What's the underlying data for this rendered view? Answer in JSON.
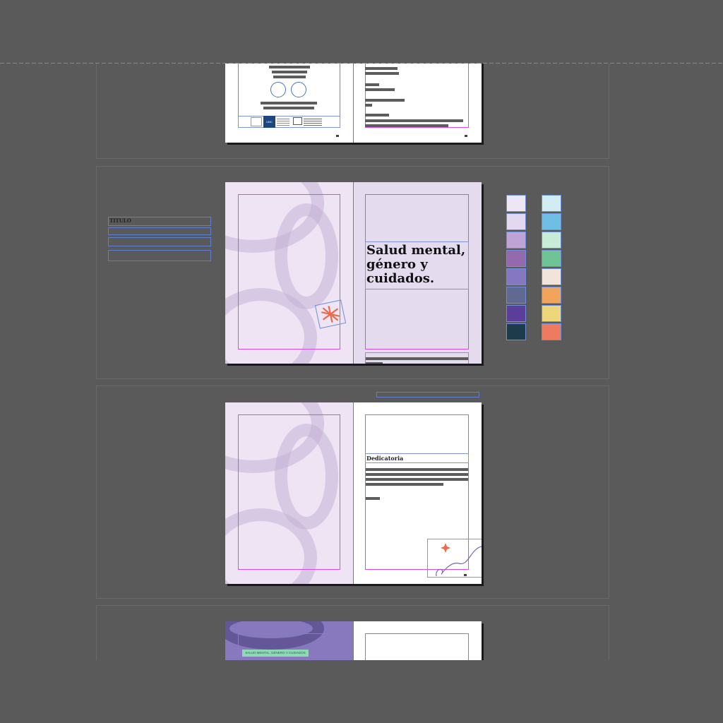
{
  "spread2": {
    "title_parts": {
      "line1": "Salud mental,",
      "line2": "género y",
      "line3": "cuidados."
    },
    "pasteboard_label": "TITULO"
  },
  "spread3": {
    "heading": "Dedicatoria"
  },
  "spread1": {
    "logo_text": "UNC"
  },
  "spread4": {
    "tag": "SALUD MENTAL, GÉNERO Y CUIDADOS"
  },
  "swatches": {
    "left": [
      "#ede6f5",
      "#e2d8ef",
      "#c0a3d6",
      "#9469ad",
      "#8578c0",
      "#606a90",
      "#5b3d9a",
      "#1e3b4c"
    ],
    "right": [
      "#d2ecf3",
      "#6fbfe5",
      "#c6ecd7",
      "#6fc495",
      "#f1e4d9",
      "#f0a45c",
      "#eed67a",
      "#ee7a60"
    ]
  },
  "colors": {
    "canvas": "#5a5a5a",
    "margin_guide": "#d64bf0",
    "frame": "#7e94d6",
    "accent_orange": "#ee6a4a"
  }
}
